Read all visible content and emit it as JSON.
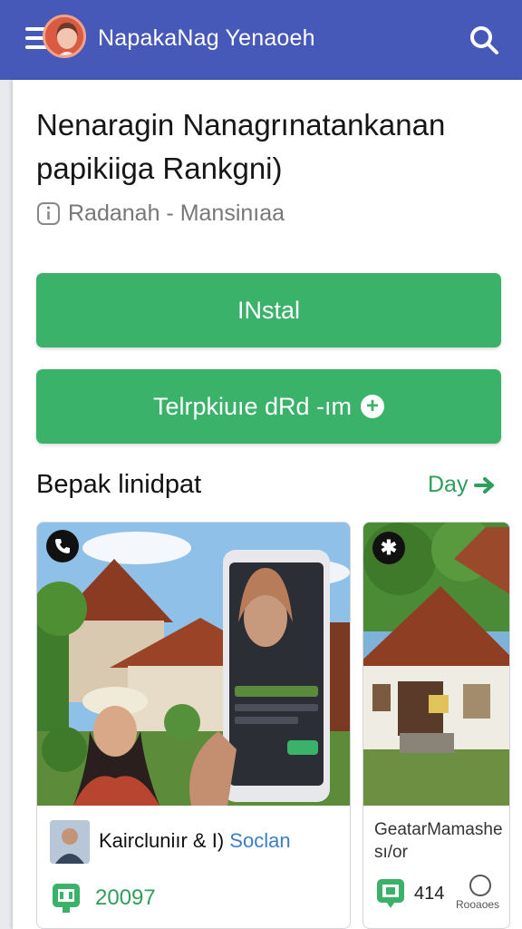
{
  "appbar": {
    "title": "NapakaNag Yenaoeh",
    "menu_icon": "hamburger-icon",
    "search_icon": "search-icon",
    "color": "#4658b8"
  },
  "article": {
    "headline": "Nenaragin Nanagrınatankanan papikiiga Rankgni)",
    "meta": "Radanah - Mansinıaa",
    "meta_icon": "info-icon"
  },
  "buttons": {
    "install_label": "INstal",
    "secondary_label": "Telrpkiuıe dRd -ım",
    "secondary_icon": "plus-icon",
    "color": "#3ab26a"
  },
  "section": {
    "title": "Bepak linidpat",
    "link_label": "Day",
    "link_icon": "arrow-right-icon"
  },
  "items": [
    {
      "badge_icon": "phone-icon",
      "author_name": "Kaircluniır & I)",
      "author_accent": "Soclan",
      "stat_icon": "trophy-icon",
      "stat_value": "20097"
    },
    {
      "badge_icon": "star-icon",
      "title": "GeatarMamashe sı/or",
      "stat_icon": "trophy-icon",
      "stat_value": "414",
      "reacts_icon": "circle-icon",
      "reacts_label": "Rooaoes"
    }
  ]
}
